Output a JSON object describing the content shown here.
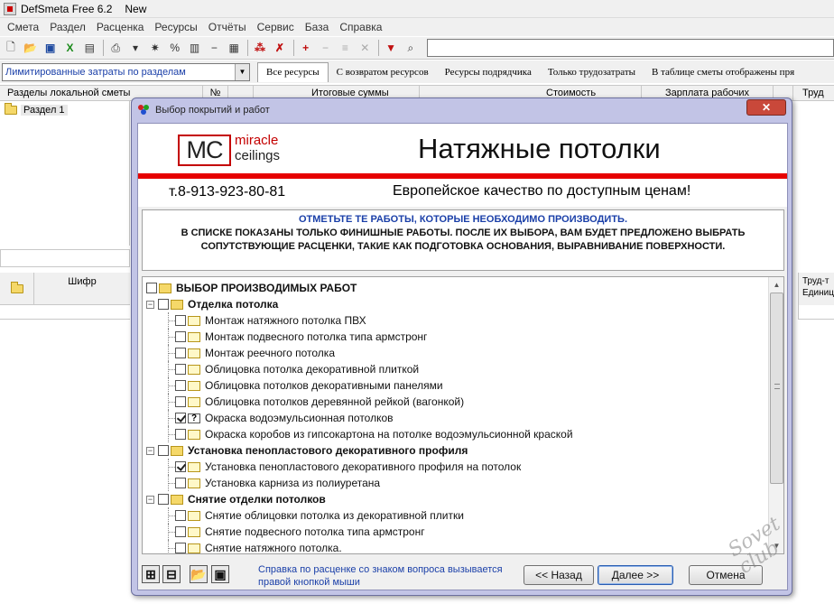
{
  "window": {
    "title": "DefSmeta Free 6.2",
    "doc": "New"
  },
  "menu": [
    "Смета",
    "Раздел",
    "Расценка",
    "Ресурсы",
    "Отчёты",
    "Сервис",
    "База",
    "Справка"
  ],
  "filter": {
    "combo_value": "Лимитированные затраты по разделам",
    "tabs": [
      "Все ресурсы",
      "С возвратом ресурсов",
      "Ресурсы подрядчика",
      "Только трудозатраты",
      "В таблице сметы отображены пря"
    ]
  },
  "grid": {
    "headers": [
      "Разделы локальной сметы",
      "№",
      "Итоговые суммы",
      "Стоимость",
      "Зарплата рабочих",
      "Труд"
    ],
    "section": "Раздел 1",
    "lower_header": "Шифр",
    "right_header": [
      "Труд-т",
      "Единиц"
    ]
  },
  "dialog": {
    "title": "Выбор покрытий и работ",
    "close": "✕",
    "logo_box": "MC",
    "logo_line1": "miracle",
    "logo_line2": "ceilings",
    "banner_title": "Натяжные потолки",
    "phone": "т.8-913-923-80-81",
    "slogan": "Европейское качество по доступным ценам!",
    "notice": {
      "line1": "ОТМЕТЬТЕ ТЕ РАБОТЫ, КОТОРЫЕ НЕОБХОДИМО ПРОИЗВОДИТЬ.",
      "line2": "В СПИСКЕ ПОКАЗАНЫ ТОЛЬКО ФИНИШНЫЕ РАБОТЫ. ПОСЛЕ ИХ ВЫБОРА, ВАМ БУДЕТ ПРЕДЛОЖЕНО ВЫБРАТЬ",
      "line3": "СОПУТСТВУЮЩИЕ РАСЦЕНКИ, ТАКИЕ КАК ПОДГОТОВКА ОСНОВАНИЯ, ВЫРАВНИВАНИЕ ПОВЕРХНОСТИ."
    },
    "tree": {
      "root": "ВЫБОР ПРОИЗВОДИМЫХ РАБОТ",
      "groups": [
        {
          "label": "Отделка потолка",
          "items": [
            {
              "label": "Монтаж натяжного потолка ПВХ",
              "checked": false,
              "q": false
            },
            {
              "label": "Монтаж подвесного  потолка типа армстронг",
              "checked": false,
              "q": false
            },
            {
              "label": "Монтаж реечного потолка",
              "checked": false,
              "q": false
            },
            {
              "label": "Облицовка потолка декоративной плиткой",
              "checked": false,
              "q": false
            },
            {
              "label": "Облицовка потолков декоративными панелями",
              "checked": false,
              "q": false
            },
            {
              "label": "Облицовка потолков деревянной рейкой (вагонкой)",
              "checked": false,
              "q": false
            },
            {
              "label": "Окраска водоэмульсионная потолков",
              "checked": true,
              "q": true
            },
            {
              "label": "Окраска коробов из гипсокартона на потолке водоэмульсионной краской",
              "checked": false,
              "q": false
            }
          ]
        },
        {
          "label": "Установка пенопластового декоративного профиля",
          "items": [
            {
              "label": "Установка пенопластового декоративного профиля на потолок",
              "checked": true,
              "q": false
            },
            {
              "label": "Установка карниза из полиуретана",
              "checked": false,
              "q": false
            }
          ]
        },
        {
          "label": "Снятие отделки потолков",
          "items": [
            {
              "label": "Снятие облицовки потолка из декоративной плитки",
              "checked": false,
              "q": false
            },
            {
              "label": "Снятие подвесного потолка типа армстронг",
              "checked": false,
              "q": false
            },
            {
              "label": "Снятие натяжного потолка.",
              "checked": false,
              "q": false
            }
          ]
        }
      ]
    },
    "hint": {
      "line1": "Справка по расценке со знаком вопроса вызывается",
      "line2": "правой кнопкой мыши"
    },
    "buttons": {
      "back": "<< Назад",
      "next": "Далее >>",
      "cancel": "Отмена"
    }
  }
}
